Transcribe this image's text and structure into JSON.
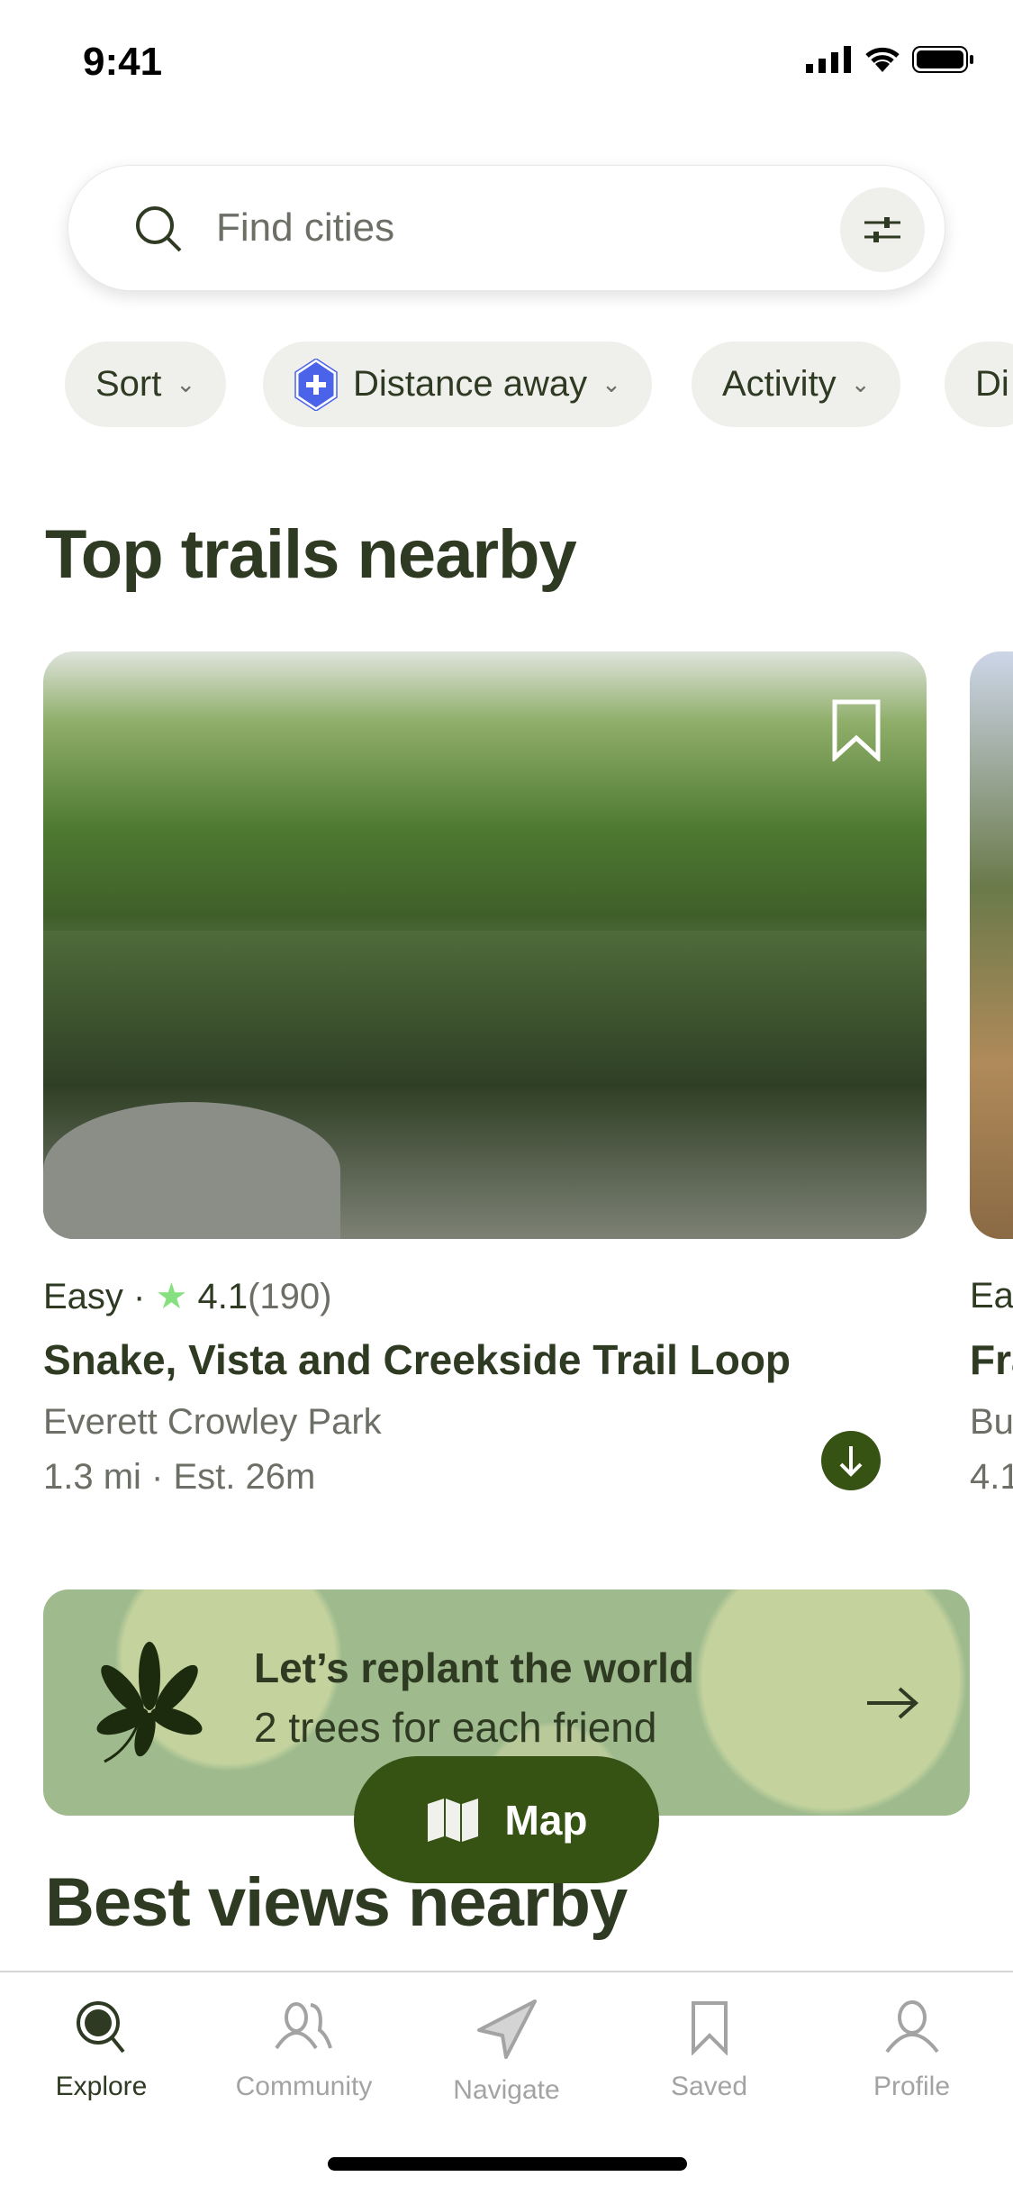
{
  "status_bar": {
    "time": "9:41"
  },
  "search": {
    "placeholder": "Find cities"
  },
  "chips": [
    {
      "label": "Sort"
    },
    {
      "label": "Distance away",
      "icon": "shield-plus-icon"
    },
    {
      "label": "Activity"
    },
    {
      "label": "Di"
    }
  ],
  "sections": {
    "top_trails": "Top trails nearby",
    "best_views": "Best views nearby"
  },
  "trail": {
    "difficulty": "Easy",
    "rating": "4.1",
    "reviews": "(190)",
    "name": "Snake, Vista and Creekside Trail Loop",
    "park": "Everett Crowley Park",
    "distance": "1.3 mi",
    "time": "Est. 26m"
  },
  "trail_next": {
    "difficulty": "Eas",
    "name": "Fra",
    "park": "Bu",
    "distance": "4.1"
  },
  "banner": {
    "line1": "Let’s replant the world",
    "line2": "2 trees for each friend"
  },
  "map_button": {
    "label": "Map"
  },
  "tabs": [
    {
      "label": "Explore",
      "active": true
    },
    {
      "label": "Community"
    },
    {
      "label": "Navigate"
    },
    {
      "label": "Saved"
    },
    {
      "label": "Profile"
    }
  ],
  "colors": {
    "primary": "#365314",
    "text": "#2f3a22",
    "star": "#86e07f",
    "badge": "#4a63e8"
  }
}
